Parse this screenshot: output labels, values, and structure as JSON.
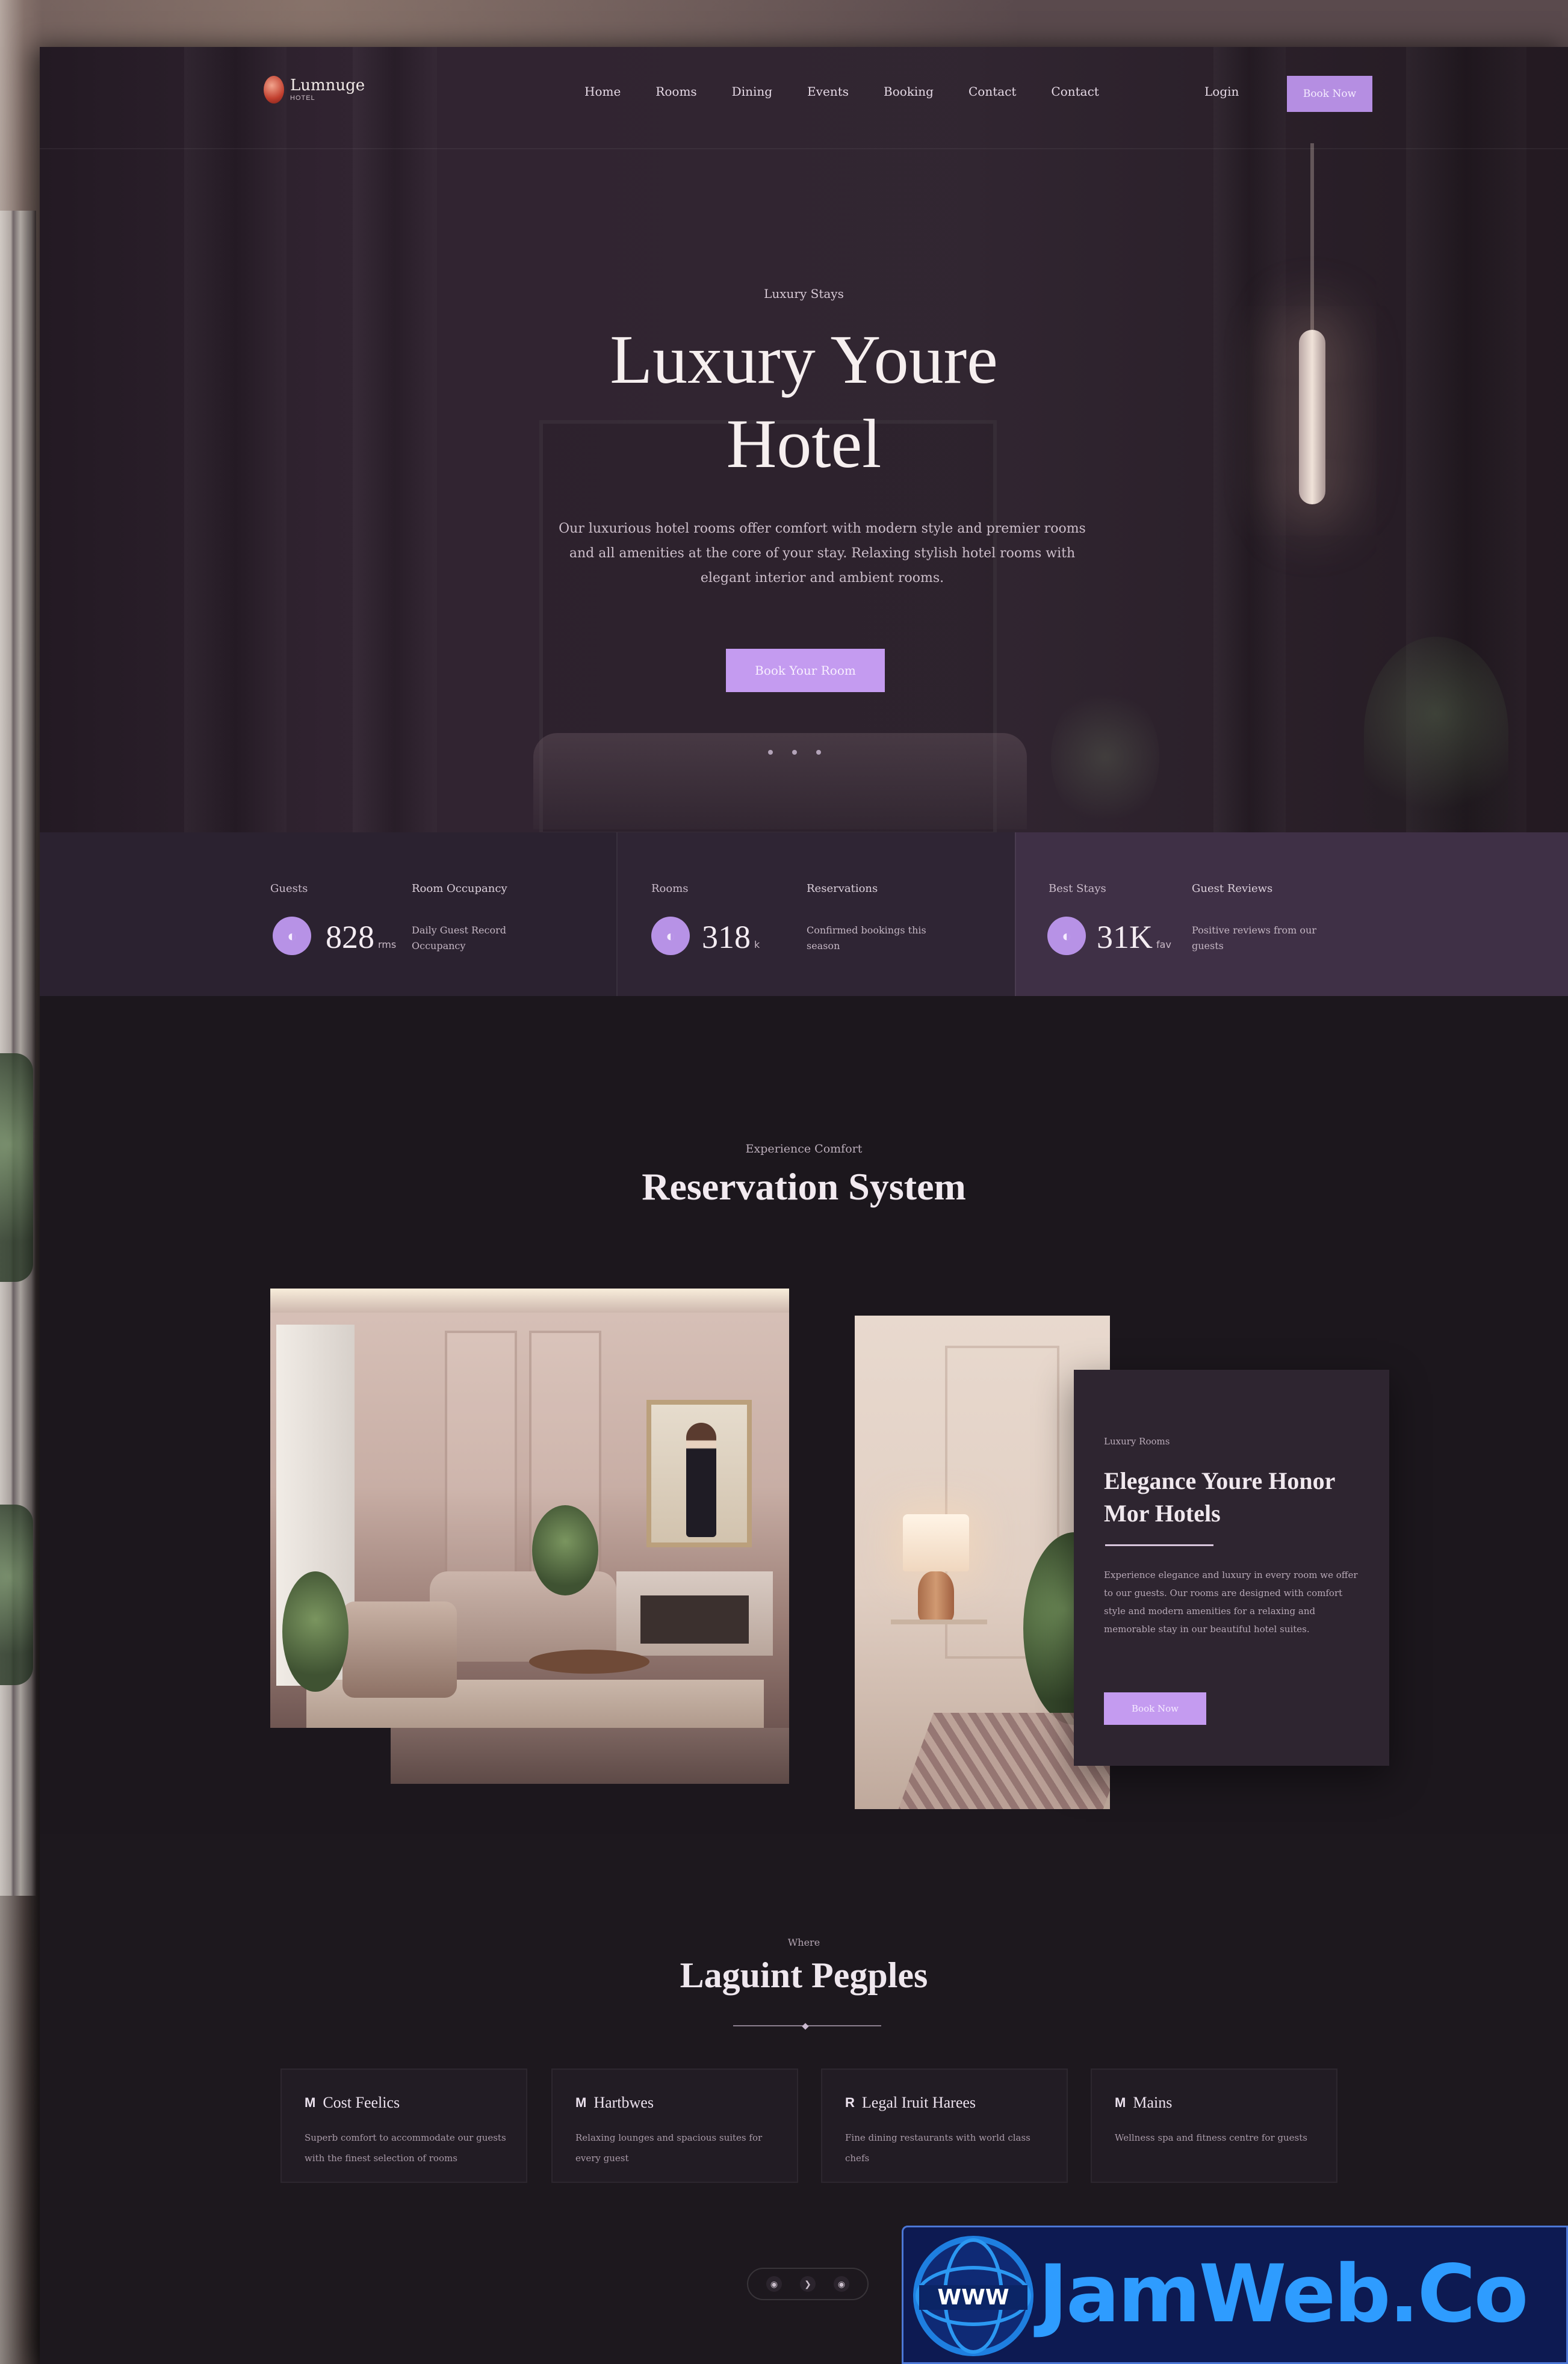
{
  "nav": {
    "logo_name": "Lumnuge",
    "logo_sub": "HOTEL",
    "links": [
      "Home",
      "Rooms",
      "Dining",
      "Events",
      "Booking",
      "Contact",
      "Contact"
    ],
    "login": "Login",
    "cta": "Book Now"
  },
  "hero": {
    "eyebrow": "Luxury Stays",
    "title_line1": "Luxury Youre",
    "title_line2": "Hotel",
    "description": "Our luxurious hotel rooms offer comfort with modern style and premier rooms and all amenities at the core of your stay. Relaxing stylish hotel rooms with elegant interior and ambient rooms.",
    "cta": "Book Your Room"
  },
  "stats": [
    {
      "eyebrow": "Guests",
      "caption_title": "Room Occupancy",
      "value": "828",
      "unit": "rms",
      "caption": "Daily Guest Record Occupancy"
    },
    {
      "eyebrow": "Rooms",
      "caption_title": "Reservations",
      "value": "318",
      "unit": "k",
      "caption": "Confirmed bookings this season"
    },
    {
      "eyebrow": "Best Stays",
      "caption_title": "Guest Reviews",
      "value": "31K",
      "unit": "fav",
      "caption": "Positive reviews from our guests"
    }
  ],
  "reservation": {
    "eyebrow": "Experience Comfort",
    "title": "Reservation System",
    "card": {
      "eyebrow": "Luxury Rooms",
      "title": "Elegance Youre Honor Mor Hotels",
      "body": "Experience elegance and luxury in every room we offer to our guests. Our rooms are designed with comfort style and modern amenities for a relaxing and memorable stay in our beautiful hotel suites.",
      "button": "Book Now"
    }
  },
  "people": {
    "eyebrow": "Where",
    "title": "Laguint Pegples",
    "features": [
      {
        "icon": "M",
        "title": "Cost Feelics",
        "desc": "Superb comfort to accommodate our guests with the finest selection of rooms"
      },
      {
        "icon": "M",
        "title": "Hartbwes",
        "desc": "Relaxing lounges and spacious suites for every guest"
      },
      {
        "icon": "R",
        "title": "Legal Iruit Harees",
        "desc": "Fine dining restaurants with world class chefs"
      },
      {
        "icon": "M",
        "title": "Mains",
        "desc": "Wellness spa and fitness centre for guests"
      }
    ],
    "pager": [
      "◉",
      "❯",
      "◉"
    ]
  },
  "watermark": {
    "badge": "WWW",
    "text": "JamWeb.Co"
  },
  "colors": {
    "accent": "#c49bf0",
    "background": "#1c171d",
    "stat_highlight": "#3f3046"
  }
}
